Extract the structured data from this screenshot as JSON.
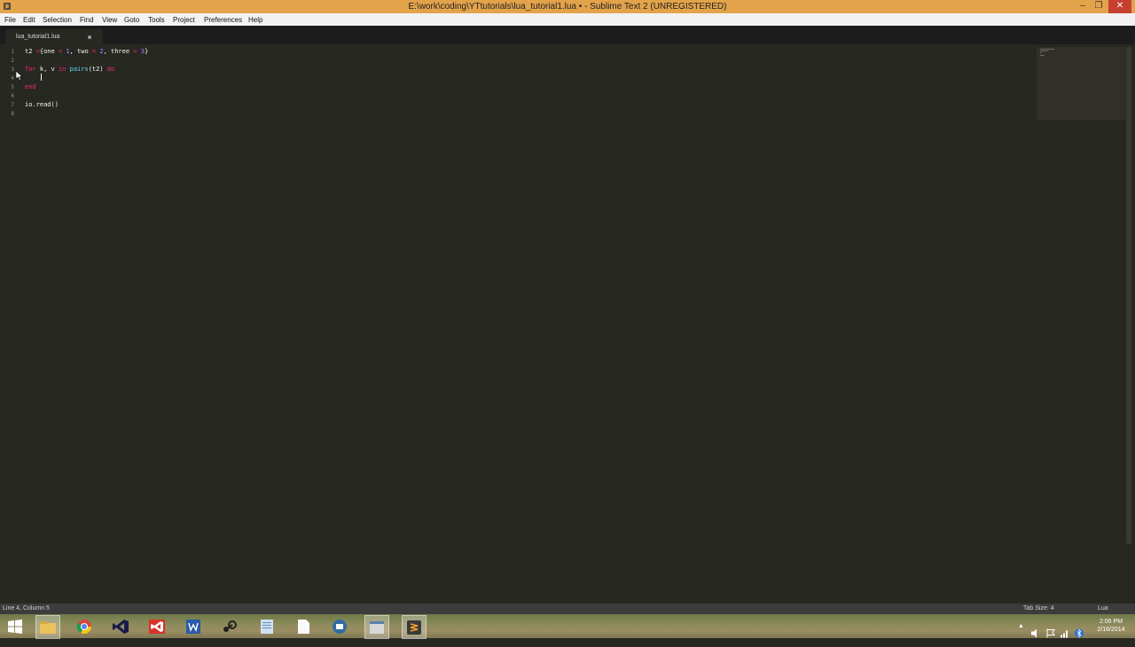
{
  "window": {
    "title": "E:\\work\\coding\\YTtutorials\\lua_tutorial1.lua • - Sublime Text 2 (UNREGISTERED)",
    "minimize_symbol": "–",
    "maximize_symbol": "❐",
    "close_symbol": "✕"
  },
  "menu": {
    "items": [
      "File",
      "Edit",
      "Selection",
      "Find",
      "View",
      "Goto",
      "Tools",
      "Project",
      "Preferences",
      "Help"
    ]
  },
  "tab": {
    "label": "lua_tutorial1.lua"
  },
  "editor": {
    "line_numbers": [
      "1",
      "2",
      "3",
      "4",
      "5",
      "6",
      "7",
      "8"
    ],
    "line1": {
      "ident": "t2 ",
      "eq": "=",
      "brace_open": "{one ",
      "eq1": "=",
      "num1": " 1",
      "sep1": ", two ",
      "eq2": "=",
      "num2": " 2",
      "sep2": ", three ",
      "eq3": "=",
      "num3": " 3",
      "brace_close": "}"
    },
    "line3": {
      "kw_for": "for",
      "vars": " k, v ",
      "kw_in": "in",
      "space": " ",
      "fn": "pairs",
      "args": "(t2) ",
      "kw_do": "do"
    },
    "line5": {
      "kw_end": "end"
    },
    "line7": {
      "text": "io.read()"
    }
  },
  "statusbar": {
    "position": "Line 4, Column 5",
    "tab_size": "Tab Size: 4",
    "syntax": "Lua"
  },
  "taskbar": {
    "apps": [
      "start-icon",
      "file-explorer-icon",
      "chrome-icon",
      "visual-studio-icon",
      "visual-studio-red-icon",
      "word-icon",
      "steam-icon",
      "document-icon",
      "file-icon",
      "remote-icon",
      "window-icon",
      "sublime-text-icon"
    ],
    "clock_time": "2:06 PM",
    "clock_date": "2/16/2014"
  },
  "colors": {
    "editor_bg": "#272822",
    "keyword": "#f92672",
    "number": "#ae81ff",
    "function": "#66d9ef",
    "text": "#f8f8f2"
  }
}
